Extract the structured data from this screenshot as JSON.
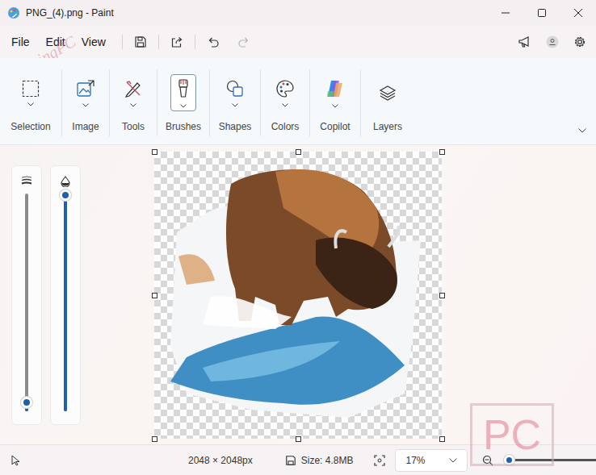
{
  "window": {
    "title": "PNG_(4).png - Paint"
  },
  "menu": [
    "File",
    "Edit",
    "View"
  ],
  "watermark": "NuimingPC",
  "ribbon": [
    {
      "label": "Selection",
      "selected": false,
      "hasMenu": true
    },
    {
      "label": "Image",
      "selected": false,
      "hasMenu": true
    },
    {
      "label": "Tools",
      "selected": false,
      "hasMenu": true
    },
    {
      "label": "Brushes",
      "selected": true,
      "hasMenu": true
    },
    {
      "label": "Shapes",
      "selected": false,
      "hasMenu": true
    },
    {
      "label": "Colors",
      "selected": false,
      "hasMenu": true
    },
    {
      "label": "Copilot",
      "selected": false,
      "hasMenu": true
    },
    {
      "label": "Layers",
      "selected": false,
      "hasMenu": false
    }
  ],
  "sliders": [
    {
      "name": "brush-size",
      "level": 0.04
    },
    {
      "name": "opacity",
      "level": 1
    }
  ],
  "status": {
    "dimensions": "2048 × 2048px",
    "size": "Size: 4.8MB",
    "zoom": "17%",
    "zoomLevel": 0.02
  },
  "logo": "PC"
}
